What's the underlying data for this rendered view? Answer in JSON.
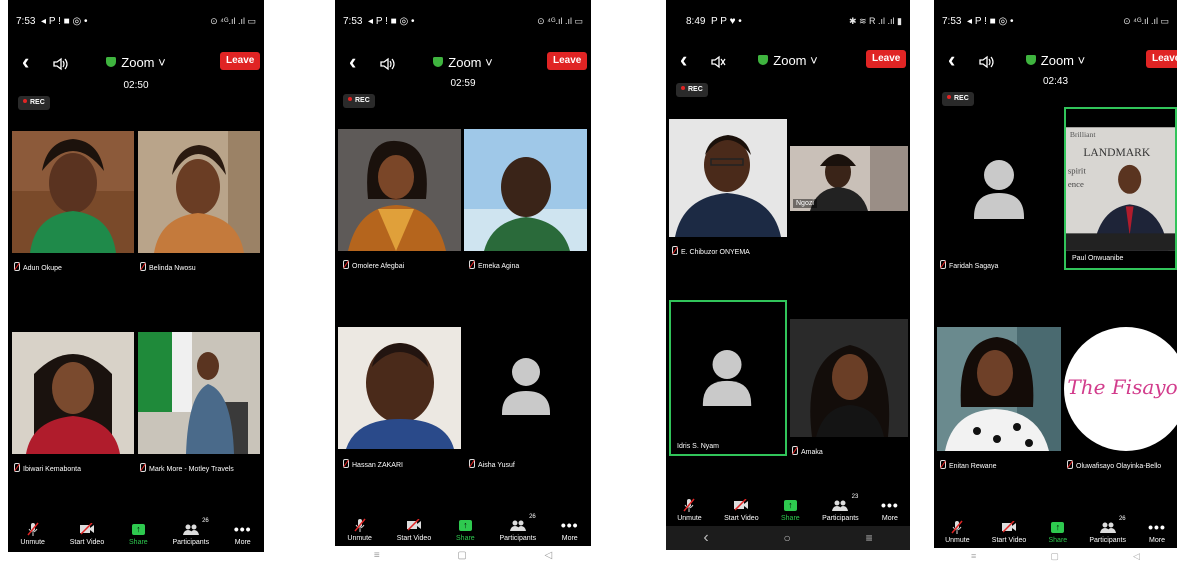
{
  "colors": {
    "leave": "#e02424",
    "active_border": "#31c45a",
    "share": "#2ec94f",
    "shield": "#3fb43f"
  },
  "icons": {
    "back": "chevron-left-icon",
    "speaker": "speaker-icon",
    "shield": "shield-check-icon",
    "mic": "mic-muted-icon",
    "video": "video-off-icon",
    "share": "share-arrow-icon",
    "participants": "people-icon",
    "more": "more-dots-icon",
    "avatar": "person-avatar-icon"
  },
  "phones": [
    {
      "status_time": "7:53",
      "status_icons": "◂ P ! ■ ◎ •",
      "status_right": "⊙ ⁴ᴳ.ıl .ıl ▭",
      "back": "‹",
      "meeting": "Zoom ˅",
      "leave": "Leave",
      "timer": "02:50",
      "rec": "REC",
      "participants": [
        "Adun Okupe",
        "Belinda Nwosu",
        "Ibiwari Kemabonta",
        "Mark More - Motley Travels"
      ],
      "bottom": {
        "unmute": "Unmute",
        "video": "Start Video",
        "share": "Share",
        "participants": "Participants",
        "count": "26",
        "more": "More",
        "dots": "•••"
      },
      "nav": [
        "≡",
        "○",
        "◁"
      ]
    },
    {
      "status_time": "7:53",
      "status_icons": "◂ P ! ■ ◎ •",
      "status_right": "⊙ ⁴ᴳ.ıl .ıl ▭",
      "back": "‹",
      "meeting": "Zoom ˅",
      "leave": "Leave",
      "timer": "02:59",
      "rec": "REC",
      "participants": [
        "Omolere Afegbai",
        "Emeka Agina",
        "Hassan ZAKARI",
        "Aisha Yusuf"
      ],
      "bottom": {
        "unmute": "Unmute",
        "video": "Start Video",
        "share": "Share",
        "participants": "Participants",
        "count": "26",
        "more": "More",
        "dots": "•••"
      },
      "nav": [
        "≡",
        "▢",
        "◁"
      ]
    },
    {
      "status_time": "8:49",
      "status_icons": "P P ♥ •",
      "status_right": "✱ ≋ R .ıl .ıl ▮",
      "back": "‹",
      "meeting": "Zoom ˅",
      "leave": "Leave",
      "rec": "REC",
      "participants": [
        "E. Chibuzor ONYEMA",
        "Ngozi",
        "Idris S. Nyam",
        "Amaka"
      ],
      "bottom": {
        "unmute": "Unmute",
        "video": "Start Video",
        "share": "Share",
        "participants": "Participants",
        "count": "23",
        "more": "More",
        "dots": "•••"
      },
      "nav": [
        "‹",
        "○",
        "≡"
      ]
    },
    {
      "status_time": "7:53",
      "status_icons": "◂ P ! ■ ◎ •",
      "status_right": "⊙ ⁴ᴳ.ıl .ıl ▭",
      "back": "‹",
      "meeting": "Zoom ˅",
      "leave": "Leave",
      "timer": "02:43",
      "rec": "REC",
      "participants": [
        "Faridah Sagaya",
        "Paul Onwuanibe",
        "Enitan Rewane",
        "Oluwafisayo Olayinka-Bello"
      ],
      "logo_text": "The Fisayo",
      "banner_text": "LANDMARK",
      "bottom": {
        "unmute": "Unmute",
        "video": "Start Video",
        "share": "Share",
        "participants": "Participants",
        "count": "26",
        "more": "More",
        "dots": "•••"
      },
      "nav": [
        "≡",
        "▢",
        "◁"
      ]
    }
  ]
}
